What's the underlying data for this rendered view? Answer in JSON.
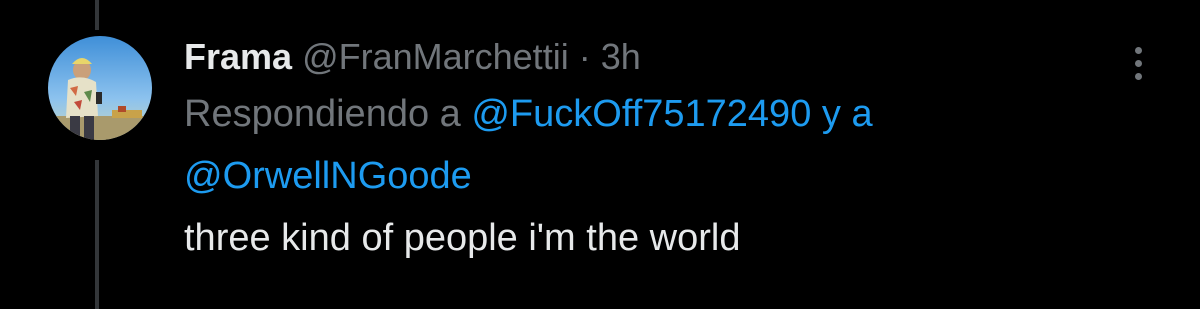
{
  "tweet": {
    "display_name": "Frama",
    "handle": "@FranMarchettii",
    "separator": "·",
    "time": "3h",
    "reply_prefix": "Respondiendo a",
    "reply_to_1": "@FuckOff75172490",
    "reply_connector": "y a",
    "reply_to_2": "@OrwellNGoode",
    "text": "three kind of people i'm the world"
  },
  "icons": {
    "avatar": "avatar-photo",
    "more": "more-options-icon"
  },
  "colors": {
    "background": "#000000",
    "primary_text": "#e7e9ea",
    "secondary_text": "#71767b",
    "link": "#1d9bf0",
    "thread_line": "#333639"
  }
}
